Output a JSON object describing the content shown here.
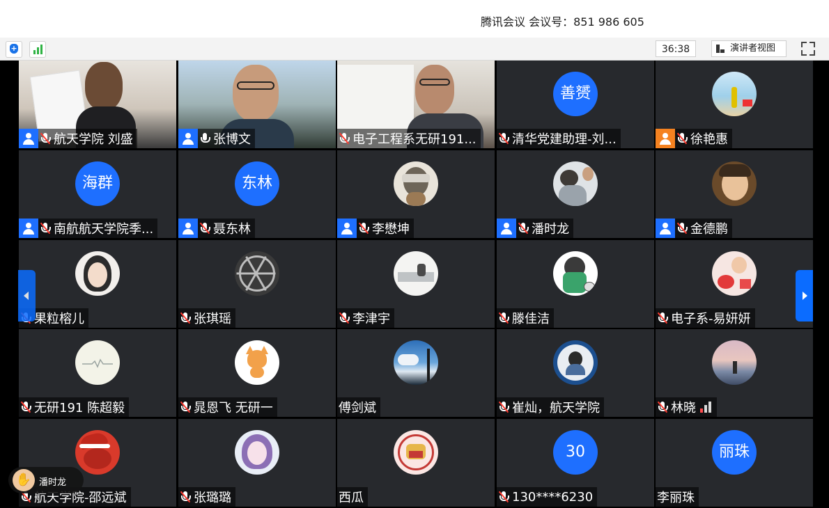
{
  "window": {
    "title": "腾讯会议 会议号：851 986 605"
  },
  "toolbar": {
    "timer": "36:38",
    "speaker_view_label": "演讲者视图"
  },
  "participants": [
    {
      "name": "航天学院 刘盛",
      "host_badge": "blue",
      "mic": "muted"
    },
    {
      "name": "张博文",
      "host_badge": "blue",
      "mic": "on"
    },
    {
      "name": "电子工程系无研191...",
      "mic": "muted"
    },
    {
      "name": "清华党建助理-刘...",
      "mic": "muted",
      "avatar_text": "善赟"
    },
    {
      "name": "徐艳惠",
      "host_badge": "orange",
      "mic": "muted"
    },
    {
      "name": "南航航天学院季...",
      "host_badge": "blue",
      "mic": "muted",
      "avatar_text": "海群"
    },
    {
      "name": "聂东林",
      "host_badge": "blue",
      "mic": "muted",
      "avatar_text": "东林"
    },
    {
      "name": "李懋坤",
      "host_badge": "blue",
      "mic": "muted"
    },
    {
      "name": "潘时龙",
      "host_badge": "blue",
      "mic": "muted"
    },
    {
      "name": "金德鹏",
      "host_badge": "blue",
      "mic": "muted"
    },
    {
      "name": "果粒榕儿",
      "mic": "muted"
    },
    {
      "name": "张琪瑶",
      "mic": "muted"
    },
    {
      "name": "李津宇",
      "mic": "muted"
    },
    {
      "name": "滕佳洁",
      "mic": "muted"
    },
    {
      "name": "电子系-易妍妍",
      "mic": "muted"
    },
    {
      "name": "无研191 陈超毅",
      "mic": "muted"
    },
    {
      "name": "晁恩飞 无研一",
      "mic": "muted"
    },
    {
      "name": "傅剑斌",
      "mic": "none"
    },
    {
      "name": "崔灿，航天学院",
      "mic": "muted"
    },
    {
      "name": "林晓",
      "mic": "muted",
      "signal": "weak"
    },
    {
      "name": "航天学院-邵远斌",
      "mic": "muted"
    },
    {
      "name": "张璐璐",
      "mic": "muted"
    },
    {
      "name": "西瓜",
      "mic": "none"
    },
    {
      "name": "130****6230",
      "mic": "muted",
      "avatar_text": "30"
    },
    {
      "name": "李丽珠",
      "mic": "none",
      "avatar_text": "丽珠"
    }
  ],
  "raise_hand": {
    "name": "潘时龙"
  },
  "colors": {
    "accent": "#1e6fff",
    "tile_bg": "#27292d",
    "muted_red": "#ff3b30"
  }
}
